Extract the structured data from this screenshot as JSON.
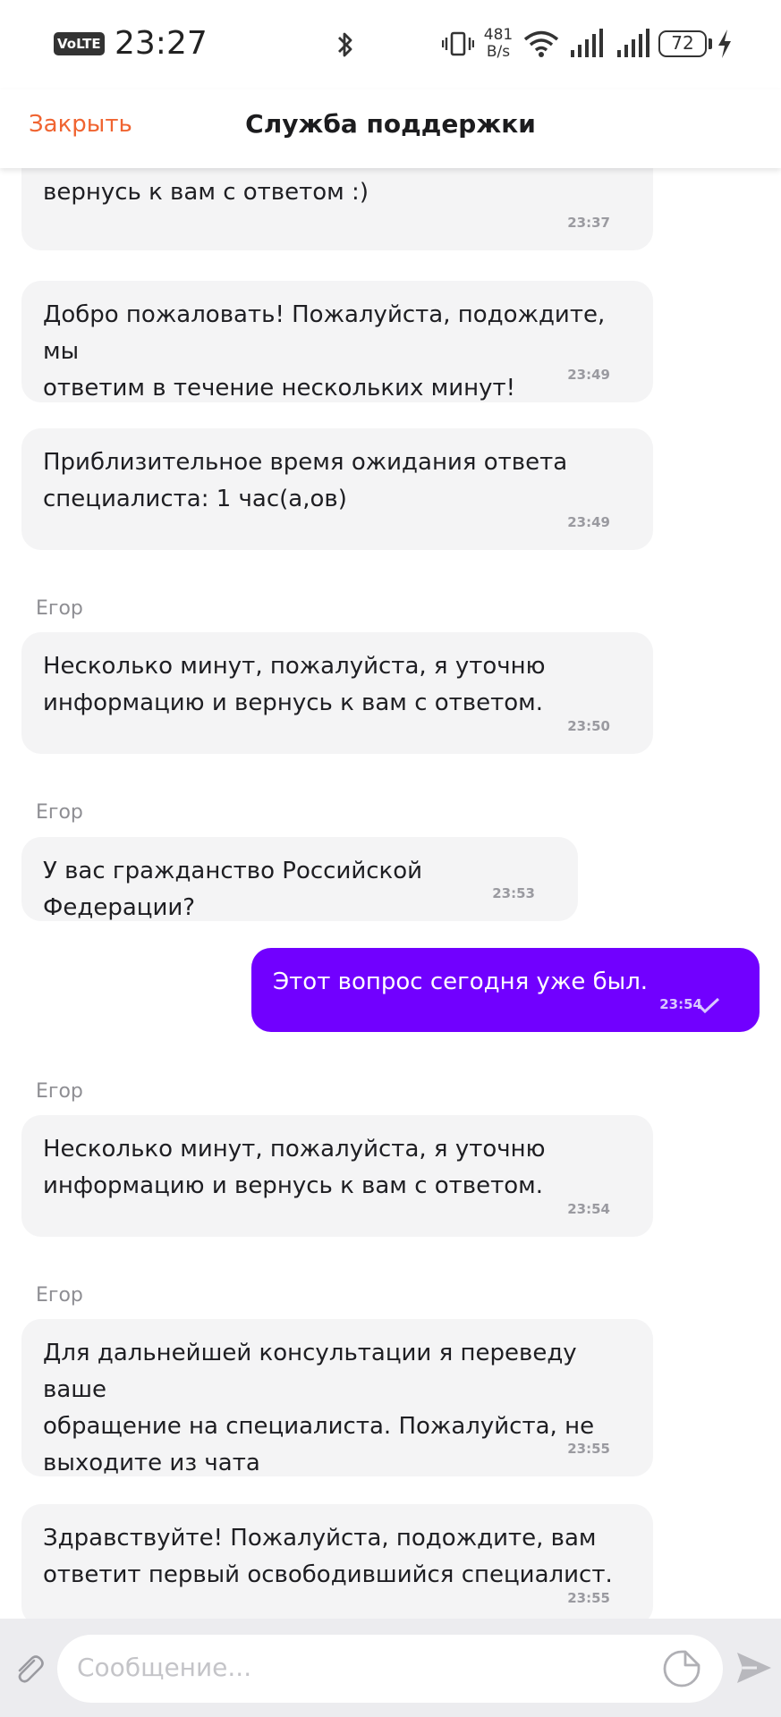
{
  "status_bar": {
    "volte": "VoLTE",
    "time": "23:27",
    "speed_value": "481",
    "speed_unit": "B/s",
    "battery": "72"
  },
  "header": {
    "close_label": "Закрыть",
    "title": "Служба поддержки"
  },
  "messages": [
    {
      "text": "Здравствуйте! Сейчас проверю информацию и\nвернусь к вам с ответом :)",
      "time": "23:37"
    },
    {
      "text": "Добро пожаловать! Пожалуйста, подождите, мы\nответим в течение нескольких минут!",
      "time": "23:49"
    },
    {
      "text": "Приблизительное время ожидания ответа\nспециалиста: 1 час(а,ов)",
      "time": "23:49"
    },
    {
      "sender": "Егор",
      "text": "Несколько минут, пожалуйста, я уточню\nинформацию и вернусь к вам с ответом.",
      "time": "23:50"
    },
    {
      "sender": "Егор",
      "text": "У вас гражданство Российской Федерации?",
      "time": "23:53"
    },
    {
      "text": "Этот вопрос сегодня уже был.",
      "time": "23:54",
      "outgoing": true
    },
    {
      "sender": "Егор",
      "text": "Несколько минут, пожалуйста, я уточню\nинформацию и вернусь к вам с ответом.",
      "time": "23:54"
    },
    {
      "sender": "Егор",
      "text": "Для дальнейшей консультации я переведу ваше\nобращение на специалиста. Пожалуйста, не\nвыходите из чата",
      "time": "23:55"
    },
    {
      "text": "Здравствуйте! Пожалуйста, подождите, вам\nответит первый освободившийся специалист.",
      "time": "23:55"
    }
  ],
  "composer": {
    "placeholder": "Сообщение..."
  },
  "colors": {
    "accent": "#f06431",
    "outgoing_bubble": "#7100ff",
    "incoming_bubble": "#f4f4f5"
  }
}
